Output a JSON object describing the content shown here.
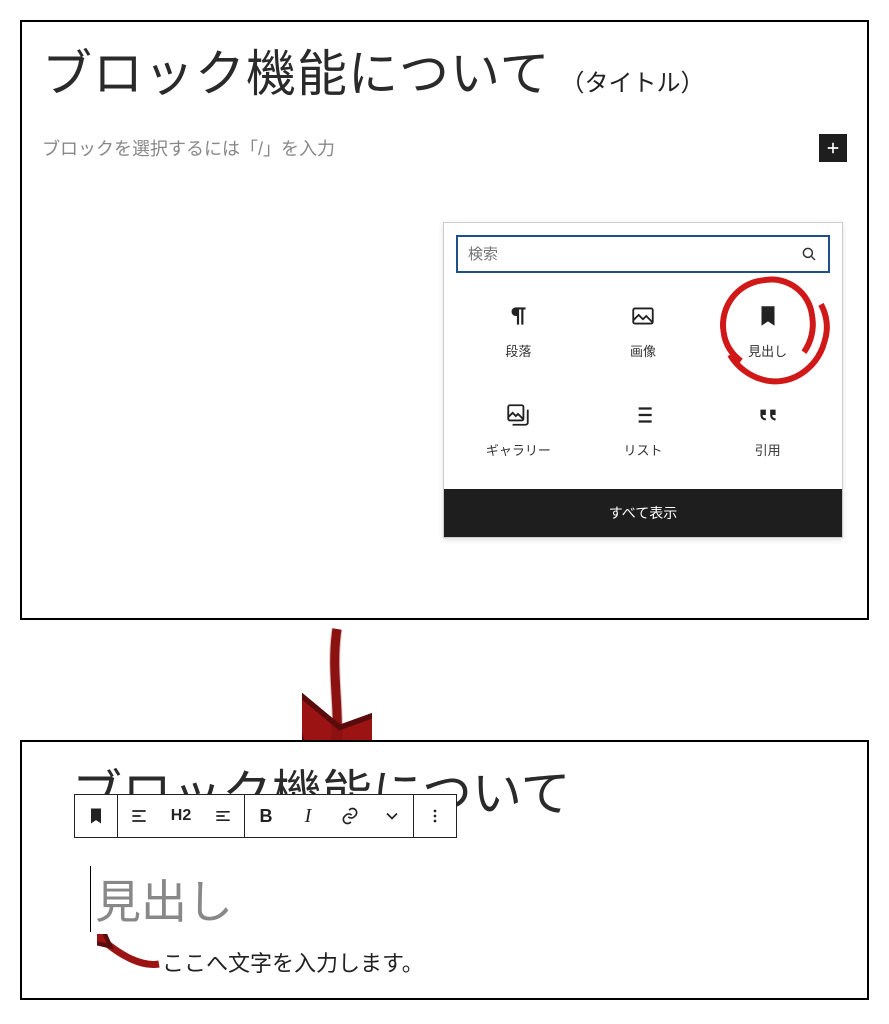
{
  "panel1": {
    "title": "ブロック機能について",
    "title_annot": "（タイトル）",
    "prompt": "ブロックを選択するには「/」を入力",
    "inserter": {
      "search_placeholder": "検索",
      "blocks": [
        {
          "name": "paragraph",
          "label": "段落"
        },
        {
          "name": "image",
          "label": "画像"
        },
        {
          "name": "heading",
          "label": "見出し",
          "highlighted": true
        },
        {
          "name": "gallery",
          "label": "ギャラリー"
        },
        {
          "name": "list",
          "label": "リスト"
        },
        {
          "name": "quote",
          "label": "引用"
        }
      ],
      "show_all": "すべて表示"
    }
  },
  "panel2": {
    "title": "ブロック機能について",
    "toolbar": {
      "heading_level": "H2"
    },
    "heading_placeholder": "見出し",
    "annot": "ここへ文字を入力します。"
  }
}
